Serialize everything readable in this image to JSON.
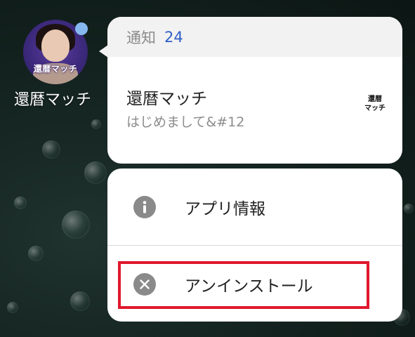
{
  "app": {
    "name": "還暦マッチ",
    "icon_brand_text": "還暦マッチ",
    "notification_dot_color": "#86b8f0"
  },
  "notification": {
    "header_label": "通知",
    "count": "24",
    "title": "還暦マッチ",
    "text": "はじめまして&#12",
    "thumbnail_text": "還暦\nマッチ"
  },
  "actions": [
    {
      "label": "アプリ情報",
      "icon": "info-icon"
    },
    {
      "label": "アンインストール",
      "icon": "close-circle-icon"
    }
  ],
  "colors": {
    "count_blue": "#2f5fc7",
    "highlight_red": "#e0182d",
    "action_icon_gray": "#8a8a8a"
  }
}
